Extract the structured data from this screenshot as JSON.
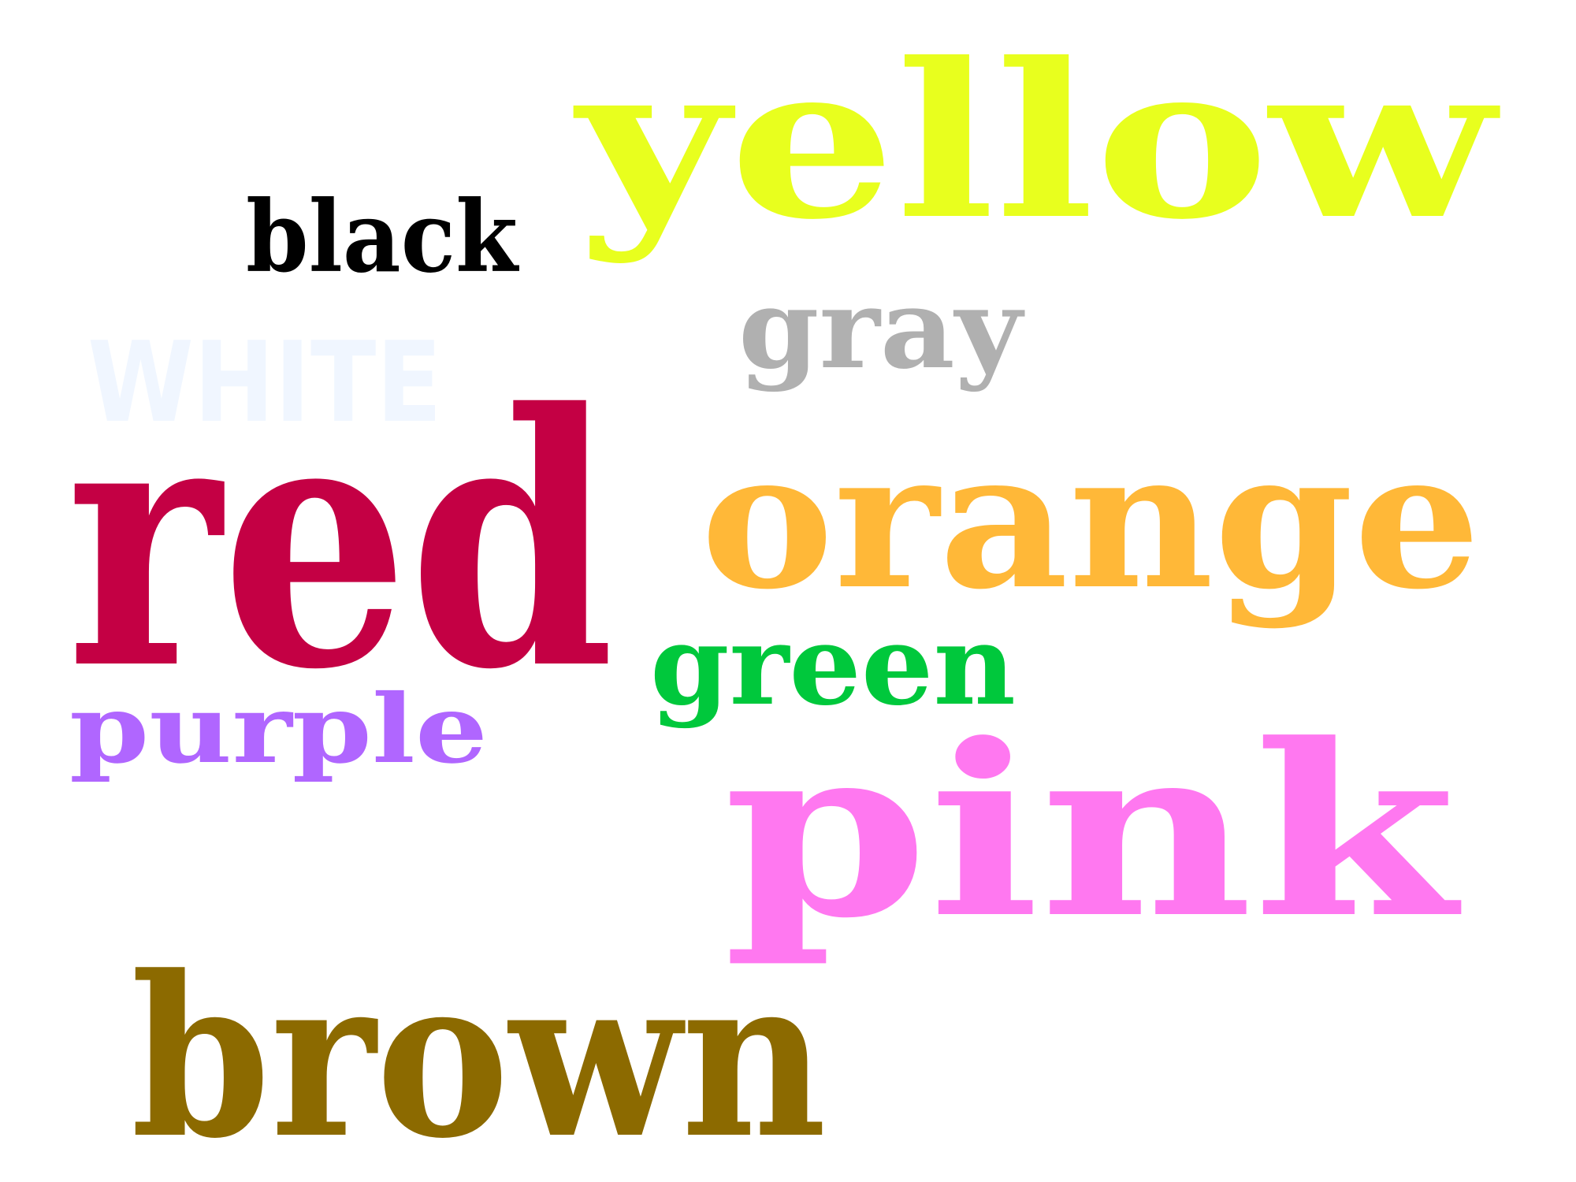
{
  "words": [
    {
      "text": "yellow",
      "color": "#e8ff1e"
    },
    {
      "text": "black",
      "color": "#000000"
    },
    {
      "text": "gray",
      "color": "#b0b0b0"
    },
    {
      "text": "WHITE",
      "color": "#f0f6ff"
    },
    {
      "text": "red",
      "color": "#c40044"
    },
    {
      "text": "orange",
      "color": "#ffb838"
    },
    {
      "text": "green",
      "color": "#00c83c"
    },
    {
      "text": "purple",
      "color": "#b066ff"
    },
    {
      "text": "pink",
      "color": "#ff78f0"
    },
    {
      "text": "brown",
      "color": "#8c6a00"
    }
  ]
}
